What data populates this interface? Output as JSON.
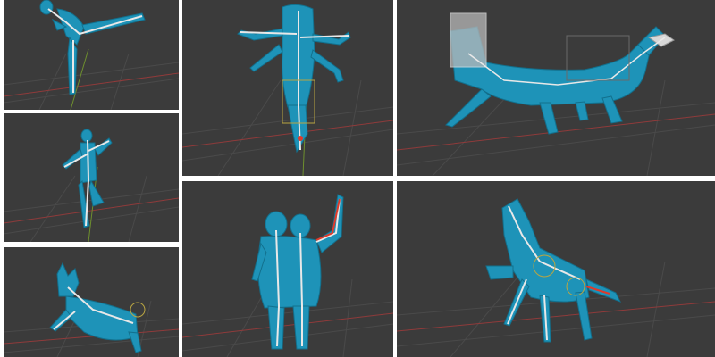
{
  "viewports": [
    {
      "id": "viewport-kick-pose",
      "model": "humanoid-kick-rig"
    },
    {
      "id": "viewport-dance-pose",
      "model": "humanoid-dance-rig"
    },
    {
      "id": "viewport-cat-leap",
      "model": "cat-rig"
    },
    {
      "id": "viewport-multi-arm",
      "model": "multi-arm-creature-rig"
    },
    {
      "id": "viewport-twin-figures",
      "model": "two-head-figure-rig"
    },
    {
      "id": "viewport-dragon",
      "model": "dragon-rig"
    },
    {
      "id": "viewport-rearing-horse",
      "model": "horse-rig"
    }
  ],
  "colors": {
    "viewport_bg": "#3b3b3b",
    "mesh": "#1e93b8",
    "mesh_dark": "#12708d",
    "bone": "#e8e8e8",
    "grid": "#4a4a4a",
    "axis_x": "#8f3b3b",
    "axis_y": "#6e8f2e",
    "highlight": "#e03a2a",
    "selection": "#b9a542"
  }
}
